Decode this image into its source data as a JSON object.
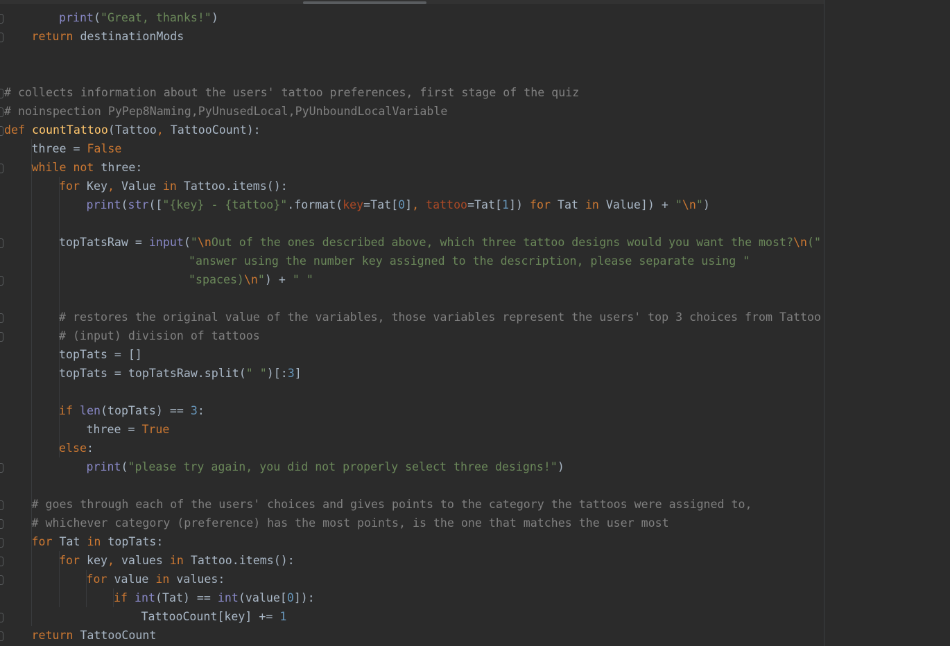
{
  "editor": {
    "colors": {
      "background": "#2b2b2b",
      "keyword": "#cc7832",
      "function": "#ffc66d",
      "builtin": "#8888c6",
      "string": "#6a8759",
      "comment": "#808080",
      "number": "#6897bb",
      "param": "#aa4926",
      "plain": "#a9b7c6"
    },
    "lines": [
      {
        "indent": 2,
        "fold": true,
        "tokens": [
          [
            "builtin",
            "print"
          ],
          [
            "plain",
            "("
          ],
          [
            "string",
            "\"Great, thanks!\""
          ],
          [
            "plain",
            ")"
          ]
        ]
      },
      {
        "indent": 1,
        "fold": true,
        "tokens": [
          [
            "keyword",
            "return "
          ],
          [
            "plain",
            "destinationMods"
          ]
        ]
      },
      {
        "indent": 0,
        "fold": false,
        "tokens": []
      },
      {
        "indent": 0,
        "fold": false,
        "tokens": []
      },
      {
        "indent": 0,
        "fold": true,
        "tokens": [
          [
            "comment",
            "# collects information about the users' tattoo preferences, first stage of the quiz"
          ]
        ]
      },
      {
        "indent": 0,
        "fold": true,
        "tokens": [
          [
            "comment",
            "# noinspection PyPep8Naming,PyUnusedLocal,PyUnboundLocalVariable"
          ]
        ]
      },
      {
        "indent": 0,
        "fold": true,
        "tokens": [
          [
            "keyword",
            "def "
          ],
          [
            "function",
            "countTattoo"
          ],
          [
            "plain",
            "(Tattoo"
          ],
          [
            "keyword",
            ", "
          ],
          [
            "plain",
            "TattooCount):"
          ]
        ]
      },
      {
        "indent": 1,
        "fold": false,
        "tokens": [
          [
            "plain",
            "three = "
          ],
          [
            "keyword",
            "False"
          ]
        ]
      },
      {
        "indent": 1,
        "fold": true,
        "tokens": [
          [
            "keyword",
            "while not "
          ],
          [
            "plain",
            "three:"
          ]
        ]
      },
      {
        "indent": 2,
        "fold": false,
        "tokens": [
          [
            "keyword",
            "for "
          ],
          [
            "plain",
            "Key"
          ],
          [
            "keyword",
            ", "
          ],
          [
            "plain",
            "Value "
          ],
          [
            "keyword",
            "in "
          ],
          [
            "plain",
            "Tattoo.items():"
          ]
        ]
      },
      {
        "indent": 3,
        "fold": false,
        "tokens": [
          [
            "builtin",
            "print"
          ],
          [
            "plain",
            "("
          ],
          [
            "builtin",
            "str"
          ],
          [
            "plain",
            "(["
          ],
          [
            "string",
            "\"{key} - {tattoo}\""
          ],
          [
            "plain",
            ".format("
          ],
          [
            "param",
            "key"
          ],
          [
            "plain",
            "=Tat["
          ],
          [
            "number",
            "0"
          ],
          [
            "plain",
            "]"
          ],
          [
            "keyword",
            ", "
          ],
          [
            "param",
            "tattoo"
          ],
          [
            "plain",
            "=Tat["
          ],
          [
            "number",
            "1"
          ],
          [
            "plain",
            "]) "
          ],
          [
            "keyword",
            "for "
          ],
          [
            "plain",
            "Tat "
          ],
          [
            "keyword",
            "in "
          ],
          [
            "plain",
            "Value]) + "
          ],
          [
            "string",
            "\""
          ],
          [
            "escape",
            "\\n"
          ],
          [
            "string",
            "\""
          ],
          [
            "plain",
            ")"
          ]
        ]
      },
      {
        "indent": 0,
        "fold": false,
        "tokens": []
      },
      {
        "indent": 2,
        "fold": true,
        "tokens": [
          [
            "plain",
            "topTatsRaw = "
          ],
          [
            "builtin",
            "input"
          ],
          [
            "plain",
            "("
          ],
          [
            "string",
            "\""
          ],
          [
            "escape",
            "\\n"
          ],
          [
            "string",
            "Out of the ones described above, which three tattoo designs would you want the most?"
          ],
          [
            "escape",
            "\\n"
          ],
          [
            "string",
            "(\""
          ]
        ]
      },
      {
        "indent": 0,
        "pad": 272,
        "fold": false,
        "tokens": [
          [
            "string",
            "\"answer using the number key assigned to the description, please separate using \""
          ]
        ]
      },
      {
        "indent": 0,
        "pad": 272,
        "fold": true,
        "tokens": [
          [
            "string",
            "\"spaces)"
          ],
          [
            "escape",
            "\\n"
          ],
          [
            "string",
            "\""
          ],
          [
            "plain",
            ") + "
          ],
          [
            "string",
            "\" \""
          ]
        ]
      },
      {
        "indent": 0,
        "fold": false,
        "tokens": []
      },
      {
        "indent": 2,
        "fold": true,
        "tokens": [
          [
            "comment",
            "# restores the original value of the variables, those variables represent the users' top 3 choices from Tattoo"
          ]
        ]
      },
      {
        "indent": 2,
        "fold": true,
        "tokens": [
          [
            "comment",
            "# (input) division of tattoos"
          ]
        ]
      },
      {
        "indent": 2,
        "fold": false,
        "tokens": [
          [
            "plain",
            "topTats = []"
          ]
        ]
      },
      {
        "indent": 2,
        "fold": false,
        "tokens": [
          [
            "plain",
            "topTats = topTatsRaw.split("
          ],
          [
            "string",
            "\" \""
          ],
          [
            "plain",
            ")[:"
          ],
          [
            "number",
            "3"
          ],
          [
            "plain",
            "]"
          ]
        ]
      },
      {
        "indent": 0,
        "fold": false,
        "tokens": []
      },
      {
        "indent": 2,
        "fold": false,
        "tokens": [
          [
            "keyword",
            "if "
          ],
          [
            "builtin",
            "len"
          ],
          [
            "plain",
            "(topTats) == "
          ],
          [
            "number",
            "3"
          ],
          [
            "plain",
            ":"
          ]
        ]
      },
      {
        "indent": 3,
        "fold": false,
        "tokens": [
          [
            "plain",
            "three = "
          ],
          [
            "keyword",
            "True"
          ]
        ]
      },
      {
        "indent": 2,
        "fold": false,
        "tokens": [
          [
            "keyword",
            "else"
          ],
          [
            "plain",
            ":"
          ]
        ]
      },
      {
        "indent": 3,
        "fold": true,
        "tokens": [
          [
            "builtin",
            "print"
          ],
          [
            "plain",
            "("
          ],
          [
            "string",
            "\"please try again, you did not properly select three designs!\""
          ],
          [
            "plain",
            ")"
          ]
        ]
      },
      {
        "indent": 0,
        "fold": false,
        "tokens": []
      },
      {
        "indent": 1,
        "fold": true,
        "tokens": [
          [
            "comment",
            "# goes through each of the users' choices and gives points to the category the tattoos were assigned to,"
          ]
        ]
      },
      {
        "indent": 1,
        "fold": true,
        "tokens": [
          [
            "comment",
            "# whichever category (preference) has the most points, is the one that matches the user most"
          ]
        ]
      },
      {
        "indent": 1,
        "fold": true,
        "tokens": [
          [
            "keyword",
            "for "
          ],
          [
            "plain",
            "Tat "
          ],
          [
            "keyword",
            "in "
          ],
          [
            "plain",
            "topTats:"
          ]
        ]
      },
      {
        "indent": 2,
        "fold": true,
        "tokens": [
          [
            "keyword",
            "for "
          ],
          [
            "plain",
            "key"
          ],
          [
            "keyword",
            ", "
          ],
          [
            "plain",
            "values "
          ],
          [
            "keyword",
            "in "
          ],
          [
            "plain",
            "Tattoo.items():"
          ]
        ]
      },
      {
        "indent": 3,
        "fold": true,
        "tokens": [
          [
            "keyword",
            "for "
          ],
          [
            "plain",
            "value "
          ],
          [
            "keyword",
            "in "
          ],
          [
            "plain",
            "values:"
          ]
        ]
      },
      {
        "indent": 4,
        "fold": false,
        "tokens": [
          [
            "keyword",
            "if "
          ],
          [
            "builtin",
            "int"
          ],
          [
            "plain",
            "(Tat) == "
          ],
          [
            "builtin",
            "int"
          ],
          [
            "plain",
            "(value["
          ],
          [
            "number",
            "0"
          ],
          [
            "plain",
            "]):"
          ]
        ]
      },
      {
        "indent": 5,
        "fold": true,
        "tokens": [
          [
            "plain",
            "TattooCount[key] += "
          ],
          [
            "number",
            "1"
          ]
        ]
      },
      {
        "indent": 1,
        "fold": true,
        "tokens": [
          [
            "keyword",
            "return "
          ],
          [
            "plain",
            "TattooCount"
          ]
        ]
      }
    ]
  }
}
